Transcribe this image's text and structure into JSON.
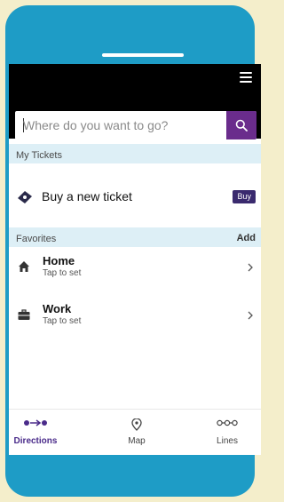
{
  "header": {
    "menu_icon": "hamburger-menu-icon"
  },
  "search": {
    "placeholder": "Where do you want to go?",
    "button_icon": "search-icon"
  },
  "my_tickets": {
    "section_label": "My Tickets",
    "buy_row_label": "Buy a new ticket",
    "buy_badge": "Buy",
    "icon": "ticket-icon"
  },
  "favorites": {
    "section_label": "Favorites",
    "add_label": "Add",
    "items": [
      {
        "title": "Home",
        "subtitle": "Tap to set",
        "icon": "home-icon"
      },
      {
        "title": "Work",
        "subtitle": "Tap to set",
        "icon": "briefcase-icon"
      }
    ]
  },
  "tabs": [
    {
      "label": "Directions",
      "icon": "directions-icon",
      "active": true
    },
    {
      "label": "Map",
      "icon": "map-pin-icon",
      "active": false
    },
    {
      "label": "Lines",
      "icon": "lines-icon",
      "active": false
    }
  ],
  "colors": {
    "background": "#f4eecb",
    "phone": "#1e9cc6",
    "header": "#000000",
    "accent": "#6a2c8c",
    "section_bg": "#ddeff6",
    "active_tab": "#4a2b8a"
  }
}
